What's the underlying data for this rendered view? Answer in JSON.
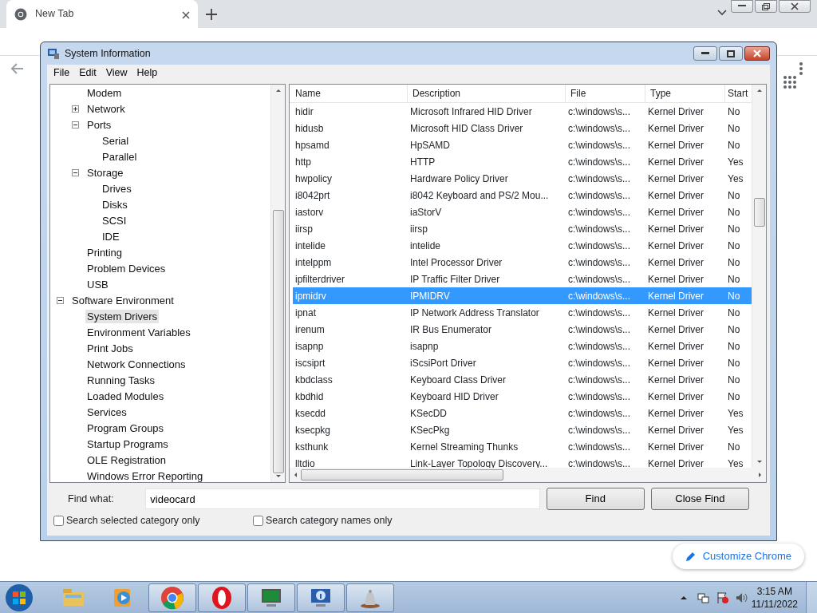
{
  "browser": {
    "tabs": [
      {
        "title": "New Tab",
        "selected": true
      }
    ],
    "customize_button": "Customize Chrome"
  },
  "window": {
    "title": "System Information",
    "menu": [
      "File",
      "Edit",
      "View",
      "Help"
    ],
    "tree": {
      "continued": [
        {
          "label": "Modem",
          "selected": false
        },
        {
          "label": "Network",
          "expanded": false,
          "selected": false
        },
        {
          "label": "Ports",
          "expanded": true,
          "selected": false,
          "children": [
            {
              "label": "Serial",
              "selected": false
            },
            {
              "label": "Parallel",
              "selected": false
            }
          ]
        },
        {
          "label": "Storage",
          "expanded": true,
          "selected": false,
          "children": [
            {
              "label": "Drives",
              "selected": false
            },
            {
              "label": "Disks",
              "selected": false
            },
            {
              "label": "SCSI",
              "selected": false
            },
            {
              "label": "IDE",
              "selected": false
            }
          ]
        },
        {
          "label": "Printing",
          "selected": false
        },
        {
          "label": "Problem Devices",
          "selected": false
        },
        {
          "label": "USB",
          "selected": false
        }
      ],
      "items": [
        {
          "label": "Software Environment",
          "expanded": true,
          "selected": false,
          "children": [
            {
              "label": "System Drivers",
              "selected": true
            },
            {
              "label": "Environment Variables",
              "selected": false
            },
            {
              "label": "Print Jobs",
              "selected": false
            },
            {
              "label": "Network Connections",
              "selected": false
            },
            {
              "label": "Running Tasks",
              "selected": false
            },
            {
              "label": "Loaded Modules",
              "selected": false
            },
            {
              "label": "Services",
              "selected": false
            },
            {
              "label": "Program Groups",
              "selected": false
            },
            {
              "label": "Startup Programs",
              "selected": false
            },
            {
              "label": "OLE Registration",
              "selected": false
            },
            {
              "label": "Windows Error Reporting",
              "selected": false
            }
          ]
        }
      ]
    },
    "table": {
      "columns": [
        "Name",
        "Description",
        "File",
        "Type",
        "Start"
      ],
      "rows": [
        {
          "cells": [
            "hidir",
            "Microsoft Infrared HID Driver",
            "c:\\windows\\s...",
            "Kernel Driver",
            "No"
          ],
          "selected": false
        },
        {
          "cells": [
            "hidusb",
            "Microsoft HID Class Driver",
            "c:\\windows\\s...",
            "Kernel Driver",
            "No"
          ],
          "selected": false
        },
        {
          "cells": [
            "hpsamd",
            "HpSAMD",
            "c:\\windows\\s...",
            "Kernel Driver",
            "No"
          ],
          "selected": false
        },
        {
          "cells": [
            "http",
            "HTTP",
            "c:\\windows\\s...",
            "Kernel Driver",
            "Yes"
          ],
          "selected": false
        },
        {
          "cells": [
            "hwpolicy",
            "Hardware Policy Driver",
            "c:\\windows\\s...",
            "Kernel Driver",
            "Yes"
          ],
          "selected": false
        },
        {
          "cells": [
            "i8042prt",
            "i8042 Keyboard and PS/2 Mou...",
            "c:\\windows\\s...",
            "Kernel Driver",
            "No"
          ],
          "selected": false
        },
        {
          "cells": [
            "iastorv",
            "iaStorV",
            "c:\\windows\\s...",
            "Kernel Driver",
            "No"
          ],
          "selected": false
        },
        {
          "cells": [
            "iirsp",
            "iirsp",
            "c:\\windows\\s...",
            "Kernel Driver",
            "No"
          ],
          "selected": false
        },
        {
          "cells": [
            "intelide",
            "intelide",
            "c:\\windows\\s...",
            "Kernel Driver",
            "No"
          ],
          "selected": false
        },
        {
          "cells": [
            "intelppm",
            "Intel Processor Driver",
            "c:\\windows\\s...",
            "Kernel Driver",
            "No"
          ],
          "selected": false
        },
        {
          "cells": [
            "ipfilterdriver",
            "IP Traffic Filter Driver",
            "c:\\windows\\s...",
            "Kernel Driver",
            "No"
          ],
          "selected": false
        },
        {
          "cells": [
            "ipmidrv",
            "IPMIDRV",
            "c:\\windows\\s...",
            "Kernel Driver",
            "No"
          ],
          "selected": true
        },
        {
          "cells": [
            "ipnat",
            "IP Network Address Translator",
            "c:\\windows\\s...",
            "Kernel Driver",
            "No"
          ],
          "selected": false
        },
        {
          "cells": [
            "irenum",
            "IR Bus Enumerator",
            "c:\\windows\\s...",
            "Kernel Driver",
            "No"
          ],
          "selected": false
        },
        {
          "cells": [
            "isapnp",
            "isapnp",
            "c:\\windows\\s...",
            "Kernel Driver",
            "No"
          ],
          "selected": false
        },
        {
          "cells": [
            "iscsiprt",
            "iScsiPort Driver",
            "c:\\windows\\s...",
            "Kernel Driver",
            "No"
          ],
          "selected": false
        },
        {
          "cells": [
            "kbdclass",
            "Keyboard Class Driver",
            "c:\\windows\\s...",
            "Kernel Driver",
            "No"
          ],
          "selected": false
        },
        {
          "cells": [
            "kbdhid",
            "Keyboard HID Driver",
            "c:\\windows\\s...",
            "Kernel Driver",
            "No"
          ],
          "selected": false
        },
        {
          "cells": [
            "ksecdd",
            "KSecDD",
            "c:\\windows\\s...",
            "Kernel Driver",
            "Yes"
          ],
          "selected": false
        },
        {
          "cells": [
            "ksecpkg",
            "KSecPkg",
            "c:\\windows\\s...",
            "Kernel Driver",
            "Yes"
          ],
          "selected": false
        },
        {
          "cells": [
            "ksthunk",
            "Kernel Streaming Thunks",
            "c:\\windows\\s...",
            "Kernel Driver",
            "No"
          ],
          "selected": false
        },
        {
          "cells": [
            "lltdio",
            "Link-Layer Topology Discovery...",
            "c:\\windows\\s...",
            "Kernel Driver",
            "Yes"
          ],
          "selected": false
        }
      ]
    },
    "find": {
      "label": "Find what:",
      "value": "videocard",
      "buttons": [
        "Find",
        "Close Find"
      ],
      "options": [
        {
          "label": "Search selected category only",
          "checked": false
        },
        {
          "label": "Search category names only",
          "checked": false
        }
      ]
    }
  },
  "taskbar": {
    "apps": [
      {
        "kind": "folder",
        "active": false
      },
      {
        "kind": "media",
        "active": false
      },
      {
        "kind": "chrome",
        "active": true
      },
      {
        "kind": "opera",
        "active": true
      },
      {
        "kind": "monitor",
        "active": true
      },
      {
        "kind": "sysinfo",
        "active": true
      },
      {
        "kind": "bell",
        "active": true
      }
    ],
    "time": "3:15 AM",
    "date": "11/11/2022"
  }
}
